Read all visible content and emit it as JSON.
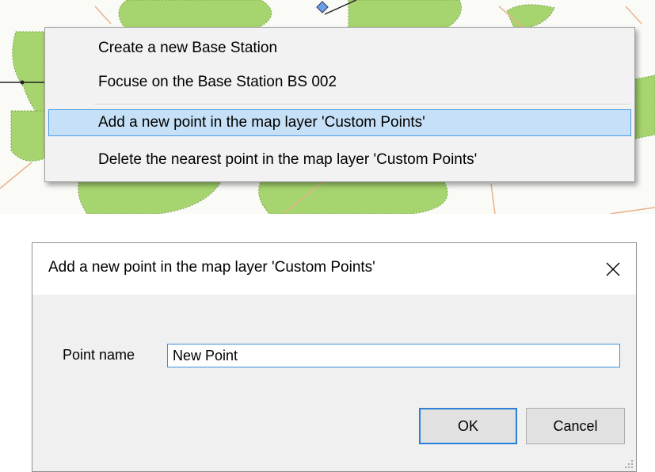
{
  "context_menu": {
    "items": [
      {
        "label": "Create a new Base Station",
        "selected": false
      },
      {
        "label": "Focuse on the Base Station BS 002",
        "selected": false
      },
      {
        "label": "Add a new point in the map layer 'Custom Points'",
        "selected": true
      },
      {
        "label": "Delete the nearest point in the map layer 'Custom Points'",
        "selected": false
      }
    ]
  },
  "dialog": {
    "title": "Add a new point in the map layer 'Custom Points'",
    "field_label": "Point name",
    "field_value": "New Point",
    "ok_label": "OK",
    "cancel_label": "Cancel"
  },
  "colors": {
    "map_green": "#a6d46e",
    "map_road": "#e8b48c",
    "menu_highlight": "#c5e0f7",
    "menu_highlight_border": "#4a9be6",
    "focus_blue": "#2a7fd6"
  },
  "icons": {
    "close": "close-icon",
    "resize": "resize-grip-icon"
  }
}
